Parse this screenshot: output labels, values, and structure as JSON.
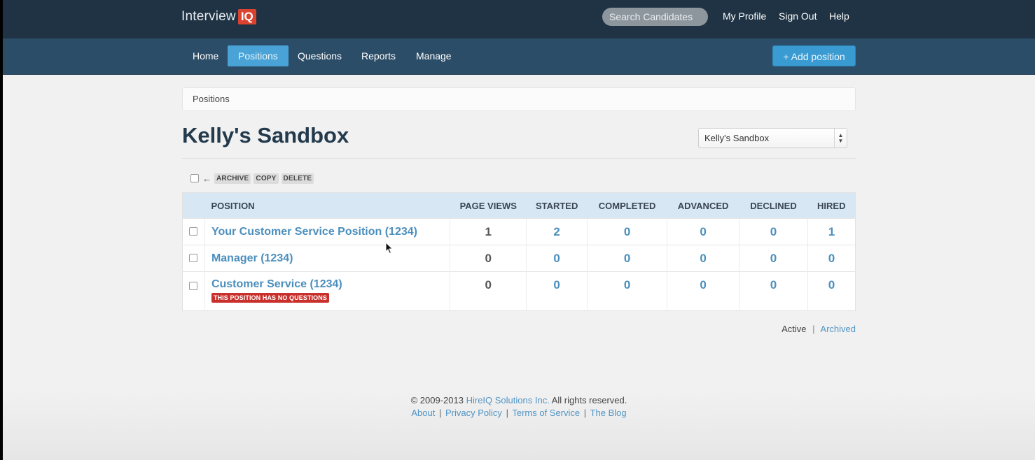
{
  "header": {
    "logo_text": "Interview",
    "logo_badge": "IQ",
    "search_placeholder": "Search Candidates",
    "links": [
      "My Profile",
      "Sign Out",
      "Help"
    ]
  },
  "nav": {
    "items": [
      "Home",
      "Positions",
      "Questions",
      "Reports",
      "Manage"
    ],
    "active": "Positions",
    "add_button": "+ Add position"
  },
  "breadcrumb": "Positions",
  "page_title": "Kelly's Sandbox",
  "account_select": {
    "selected": "Kelly's Sandbox",
    "arrow_icons": [
      "▲",
      "▼"
    ]
  },
  "bulk_actions": {
    "arrow": "←",
    "buttons": [
      "ARCHIVE",
      "COPY",
      "DELETE"
    ]
  },
  "table": {
    "columns": [
      "POSITION",
      "PAGE VIEWS",
      "STARTED",
      "COMPLETED",
      "ADVANCED",
      "DECLINED",
      "HIRED"
    ],
    "rows": [
      {
        "title": "Your Customer Service Position (1234)",
        "page_views": "1",
        "started": "2",
        "completed": "0",
        "advanced": "0",
        "declined": "0",
        "hired": "1",
        "warning": ""
      },
      {
        "title": "Manager (1234)",
        "page_views": "0",
        "started": "0",
        "completed": "0",
        "advanced": "0",
        "declined": "0",
        "hired": "0",
        "warning": ""
      },
      {
        "title": "Customer Service (1234)",
        "page_views": "0",
        "started": "0",
        "completed": "0",
        "advanced": "0",
        "declined": "0",
        "hired": "0",
        "warning": "THIS POSITION HAS NO QUESTIONS"
      }
    ]
  },
  "filter": {
    "active": "Active",
    "separator": "|",
    "archived": "Archived"
  },
  "footer": {
    "copyright_prefix": "© 2009-2013",
    "company": "HireIQ Solutions Inc.",
    "copyright_suffix": "All rights reserved.",
    "links": [
      "About",
      "Privacy Policy",
      "Terms of Service",
      "The Blog"
    ],
    "separator": "|"
  },
  "colors": {
    "topbar": "#1f3344",
    "navbar": "#2c4d68",
    "accent": "#4aa3d6",
    "link": "#4b8fbd",
    "warning": "#c9302c"
  }
}
